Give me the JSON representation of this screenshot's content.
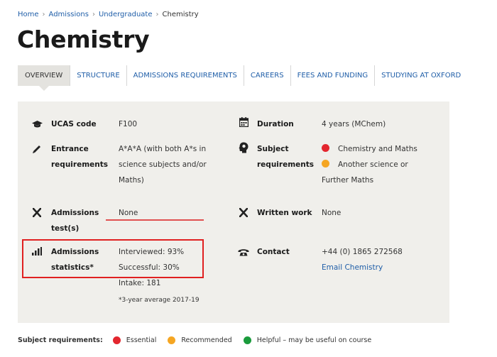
{
  "breadcrumb": {
    "items": [
      "Home",
      "Admissions",
      "Undergraduate"
    ],
    "current": "Chemistry"
  },
  "page_title": "Chemistry",
  "tabs": [
    "OVERVIEW",
    "STRUCTURE",
    "ADMISSIONS REQUIREMENTS",
    "CAREERS",
    "FEES AND FUNDING",
    "STUDYING AT OXFORD"
  ],
  "colors": {
    "essential": "#e3262e",
    "recommended": "#f5a623",
    "helpful": "#1a9b3c",
    "highlight": "#e02020",
    "panel_bg": "#f0efeb"
  },
  "facts": {
    "ucas": {
      "icon": "graduation-cap-icon",
      "label": "UCAS code",
      "value": "F100"
    },
    "entrance": {
      "icon": "pencil-icon",
      "label_line1": "Entrance",
      "label_line2": "requirements",
      "line1": "A*A*A (with both A*s in",
      "line2": "science subjects and/or",
      "line3": "Maths)"
    },
    "admissions_test": {
      "icon": "cross-icon",
      "label_line1": "Admissions",
      "label_line2": "test(s)",
      "value": "None"
    },
    "admissions_stats": {
      "icon": "bar-chart-icon",
      "label_line1": "Admissions",
      "label_line2": "statistics*",
      "interviewed": "Interviewed: 93%",
      "successful": "Successful: 30%",
      "intake": "Intake: 181",
      "footnote": "*3-year average 2017-19"
    },
    "duration": {
      "icon": "calendar-icon",
      "label": "Duration",
      "value": "4 years (MChem)"
    },
    "subject": {
      "icon": "head-icon",
      "label_line1": "Subject",
      "label_line2": "requirements",
      "essential_text": "Chemistry and Maths",
      "recommended_text_line1": "Another science or",
      "recommended_text_line2": "Further Maths"
    },
    "written_work": {
      "icon": "cross-icon",
      "label": "Written work",
      "value": "None"
    },
    "contact": {
      "icon": "phone-icon",
      "label": "Contact",
      "phone": "+44 (0) 1865 272568",
      "email_link": "Email Chemistry"
    }
  },
  "legend": {
    "title": "Subject requirements:",
    "essential": "Essential",
    "recommended": "Recommended",
    "helpful": "Helpful – may be useful on course"
  }
}
